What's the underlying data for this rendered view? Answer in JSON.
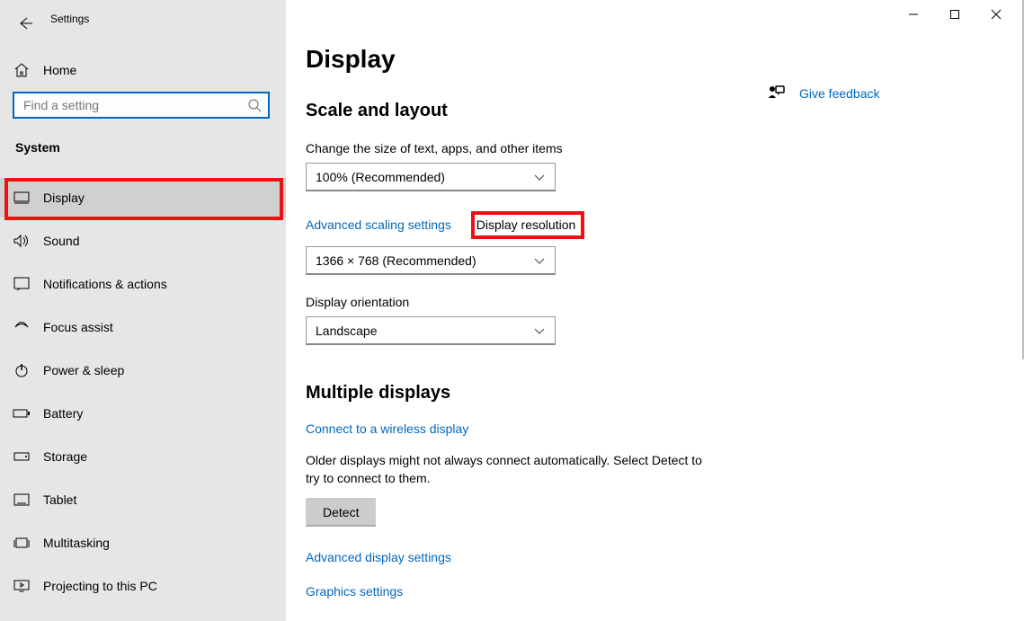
{
  "window": {
    "title": "Settings"
  },
  "sidebar": {
    "home": "Home",
    "search_placeholder": "Find a setting",
    "category": "System",
    "items": [
      {
        "icon": "display-icon",
        "label": "Display",
        "active": true
      },
      {
        "icon": "sound-icon",
        "label": "Sound"
      },
      {
        "icon": "notifications-icon",
        "label": "Notifications & actions"
      },
      {
        "icon": "focus-icon",
        "label": "Focus assist"
      },
      {
        "icon": "power-icon",
        "label": "Power & sleep"
      },
      {
        "icon": "battery-icon",
        "label": "Battery"
      },
      {
        "icon": "storage-icon",
        "label": "Storage"
      },
      {
        "icon": "tablet-icon",
        "label": "Tablet"
      },
      {
        "icon": "multitasking-icon",
        "label": "Multitasking"
      },
      {
        "icon": "projecting-icon",
        "label": "Projecting to this PC"
      }
    ]
  },
  "main": {
    "title": "Display",
    "scale_section": "Scale and layout",
    "scale_label": "Change the size of text, apps, and other items",
    "scale_value": "100% (Recommended)",
    "advanced_scaling": "Advanced scaling settings",
    "resolution_label": "Display resolution",
    "resolution_value": "1366 × 768 (Recommended)",
    "orientation_label": "Display orientation",
    "orientation_value": "Landscape",
    "multiple_section": "Multiple displays",
    "connect_wireless": "Connect to a wireless display",
    "detect_text": "Older displays might not always connect automatically. Select Detect to try to connect to them.",
    "detect_button": "Detect",
    "advanced_display": "Advanced display settings",
    "graphics_settings": "Graphics settings",
    "feedback": "Give feedback"
  },
  "highlights": {
    "nav_item": "Display",
    "field_label": "Display resolution"
  }
}
